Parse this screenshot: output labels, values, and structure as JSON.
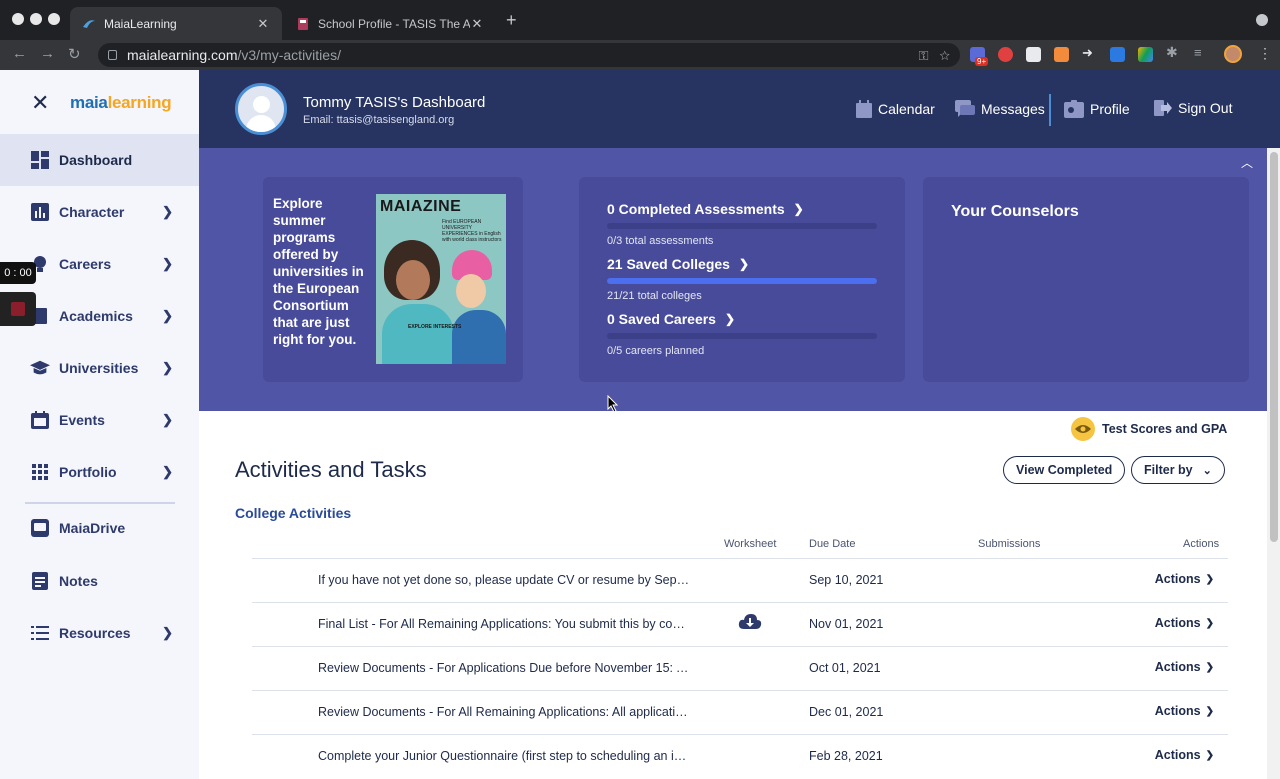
{
  "browser": {
    "tabs": [
      {
        "title": "MaiaLearning",
        "active": true
      },
      {
        "title": "School Profile - TASIS The Am",
        "active": false
      }
    ],
    "url_host": "maialearning.com",
    "url_path": "/v3/my-activities/",
    "extension_badge": "9+"
  },
  "sidebar": {
    "logo_part1": "maia",
    "logo_part2": "learning",
    "items": [
      {
        "label": "Dashboard",
        "icon": "dashboard-icon"
      },
      {
        "label": "Character",
        "icon": "bar-chart-icon"
      },
      {
        "label": "Careers",
        "icon": "lightbulb-icon"
      },
      {
        "label": "Academics",
        "icon": "book-icon"
      },
      {
        "label": "Universities",
        "icon": "graduation-cap-icon"
      },
      {
        "label": "Events",
        "icon": "calendar-icon"
      },
      {
        "label": "Portfolio",
        "icon": "grid-icon"
      },
      {
        "label": "MaiaDrive",
        "icon": "drive-icon"
      },
      {
        "label": "Notes",
        "icon": "notes-icon"
      },
      {
        "label": "Resources",
        "icon": "list-icon"
      }
    ]
  },
  "recorder": {
    "time": "0 : 00"
  },
  "header": {
    "title": "Tommy TASIS's Dashboard",
    "email": "Email: ttasis@tasisengland.org",
    "links": {
      "calendar": "Calendar",
      "messages": "Messages",
      "profile": "Profile",
      "signout": "Sign Out"
    }
  },
  "banner": {
    "promo_text": "Explore summer programs offered by universities in the European Consortium that are just right for you.",
    "magazine_title": "MAIAZINE",
    "magazine_sub": "Find EUROPEAN UNIVERSITY EXPERIENCES in English with world class instructors",
    "magazine_explore": "EXPLORE INTERESTS",
    "stats": [
      {
        "label": "0 Completed Assessments",
        "sub": "0/3 total assessments",
        "progress": 0.0
      },
      {
        "label": "21 Saved Colleges",
        "sub": "21/21 total colleges",
        "progress": 1.0
      },
      {
        "label": "0 Saved Careers",
        "sub": "0/5 careers planned",
        "progress": 0.0
      }
    ],
    "counselors_title": "Your Counselors"
  },
  "main": {
    "test_scores": "Test Scores and GPA",
    "title": "Activities and Tasks",
    "view_completed": "View Completed",
    "filter_by": "Filter by",
    "subsection": "College Activities",
    "columns": {
      "worksheet": "Worksheet",
      "due_date": "Due Date",
      "submissions": "Submissions",
      "actions": "Actions"
    },
    "rows": [
      {
        "task": "If you have not yet done so, please update CV or resume by Septem...",
        "due": "Sep 10, 2021",
        "worksheet": false,
        "action": "Actions"
      },
      {
        "task": "Final List - For All Remaining Applications: You submit this by comp...",
        "due": "Nov 01, 2021",
        "worksheet": true,
        "action": "Actions"
      },
      {
        "task": "Review Documents - For Applications Due before November 15: Al...",
        "due": "Oct 01, 2021",
        "worksheet": false,
        "action": "Actions"
      },
      {
        "task": "Review Documents - For All Remaining Applications: All application...",
        "due": "Dec 01, 2021",
        "worksheet": false,
        "action": "Actions"
      },
      {
        "task": "Complete your Junior Questionnaire (first step to scheduling an ind...",
        "due": "Feb 28, 2021",
        "worksheet": false,
        "action": "Actions"
      }
    ]
  },
  "colors": {
    "header_bg": "#273461",
    "banner_bg": "#5055a6",
    "card_bg": "#474b99",
    "progress_fill": "#4c6ff0",
    "accent_text": "#2a4a9a"
  }
}
